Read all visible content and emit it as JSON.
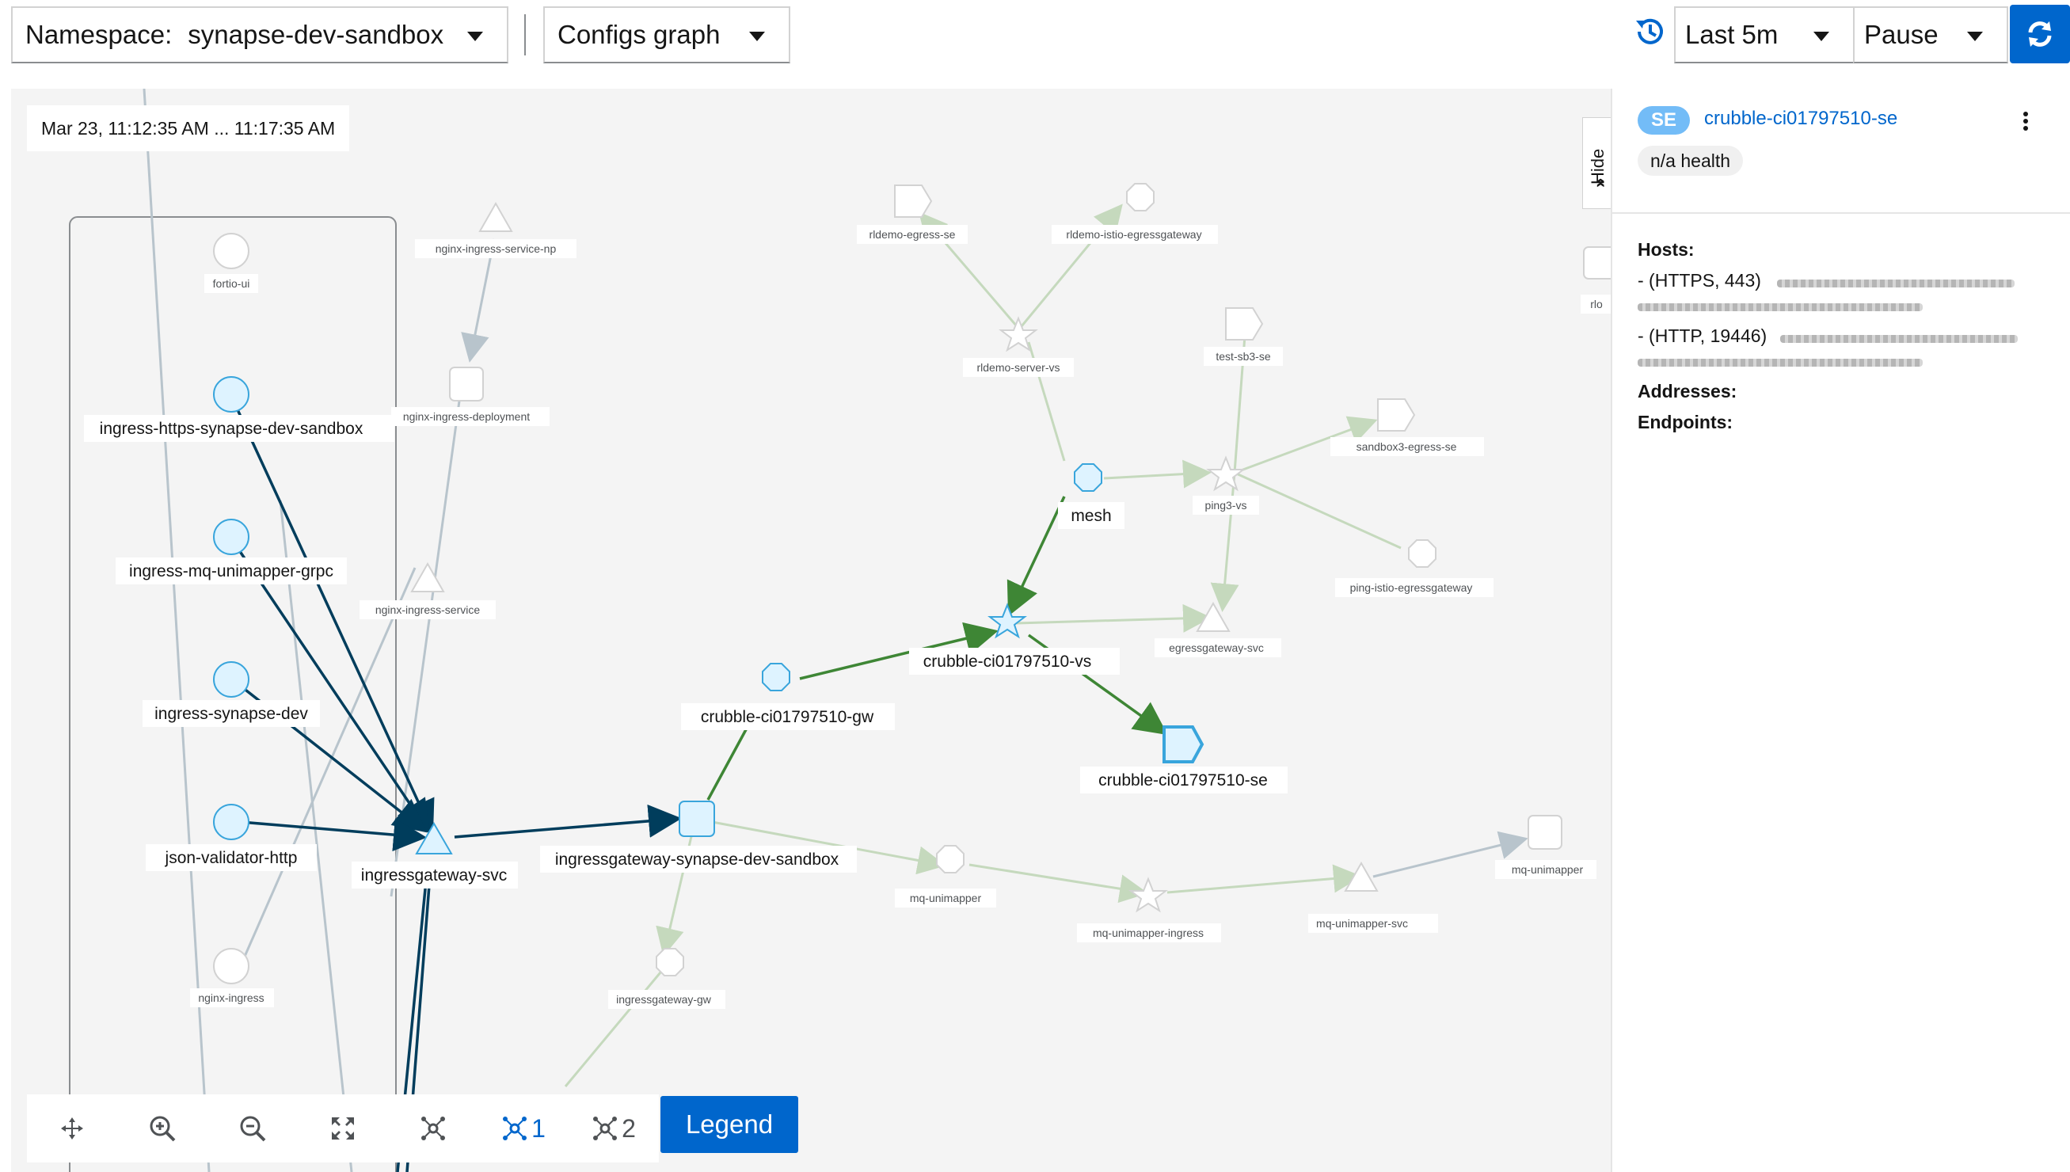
{
  "toolbar": {
    "namespace_label": "Namespace:",
    "namespace_value": "synapse-dev-sandbox",
    "graph_type": "Configs graph",
    "time_range": "Last 5m",
    "refresh_interval": "Pause"
  },
  "graph": {
    "time_window": "Mar 23, 11:12:35 AM ... 11:17:35 AM",
    "hide_label": "Hide",
    "nodes": [
      {
        "label": "fortio-ui",
        "shape": "circle",
        "style": "faded"
      },
      {
        "label": "ingress-https-synapse-dev-sandbox",
        "shape": "circle",
        "style": "active"
      },
      {
        "label": "ingress-mq-unimapper-grpc",
        "shape": "circle",
        "style": "active"
      },
      {
        "label": "ingress-synapse-dev",
        "shape": "circle",
        "style": "active"
      },
      {
        "label": "json-validator-http",
        "shape": "circle",
        "style": "active"
      },
      {
        "label": "nginx-ingress",
        "shape": "circle",
        "style": "faded"
      },
      {
        "label": "nginx-ingress-service-np",
        "shape": "triangle",
        "style": "faded"
      },
      {
        "label": "nginx-ingress-deployment",
        "shape": "square",
        "style": "faded"
      },
      {
        "label": "nginx-ingress-service",
        "shape": "triangle",
        "style": "faded"
      },
      {
        "label": "ingressgateway-svc",
        "shape": "triangle",
        "style": "active"
      },
      {
        "label": "ingressgateway-synapse-dev-sandbox",
        "shape": "square",
        "style": "active"
      },
      {
        "label": "crubble-ci01797510-gw",
        "shape": "octagon",
        "style": "active"
      },
      {
        "label": "crubble-ci01797510-vs",
        "shape": "star",
        "style": "active"
      },
      {
        "label": "crubble-ci01797510-se",
        "shape": "pentagon",
        "style": "selected"
      },
      {
        "label": "mesh",
        "shape": "octagon",
        "style": "active"
      },
      {
        "label": "rldemo-egress-se",
        "shape": "pentagon",
        "style": "faded"
      },
      {
        "label": "rldemo-istio-egressgateway",
        "shape": "octagon",
        "style": "faded"
      },
      {
        "label": "rldemo-server-vs",
        "shape": "star",
        "style": "faded"
      },
      {
        "label": "test-sb3-se",
        "shape": "pentagon",
        "style": "faded"
      },
      {
        "label": "ping3-vs",
        "shape": "star",
        "style": "faded"
      },
      {
        "label": "sandbox3-egress-se",
        "shape": "pentagon",
        "style": "faded"
      },
      {
        "label": "ping-istio-egressgateway",
        "shape": "octagon",
        "style": "faded"
      },
      {
        "label": "egressgateway-svc",
        "shape": "triangle",
        "style": "faded"
      },
      {
        "label": "mq-unimapper",
        "shape": "octagon",
        "style": "faded"
      },
      {
        "label": "mq-unimapper-ingress",
        "shape": "star",
        "style": "faded"
      },
      {
        "label": "mq-unimapper-svc",
        "shape": "triangle",
        "style": "faded"
      },
      {
        "label": "mq-unimapper",
        "shape": "square",
        "style": "faded"
      },
      {
        "label": "ingressgateway-gw",
        "shape": "octagon",
        "style": "faded"
      },
      {
        "label": "rlo",
        "shape": "square",
        "style": "faded"
      }
    ]
  },
  "side_panel": {
    "badge": "SE",
    "title": "crubble-ci01797510-se",
    "health": "n/a health",
    "hosts_label": "Hosts:",
    "hosts": [
      "- (HTTPS, 443)",
      "- (HTTP, 19446)"
    ],
    "addresses_label": "Addresses:",
    "endpoints_label": "Endpoints:"
  },
  "bottom_toolbar": {
    "layout_1": "1",
    "layout_2": "2",
    "legend": "Legend"
  },
  "colors": {
    "accent": "#0066cc",
    "edge_dark": "#003d5c",
    "edge_green": "#3e8635",
    "edge_faded_green": "#c5d9bd",
    "edge_faded_gray": "#b8c4cc",
    "node_fill_active": "#def3ff",
    "node_stroke_active": "#39a5dc"
  }
}
